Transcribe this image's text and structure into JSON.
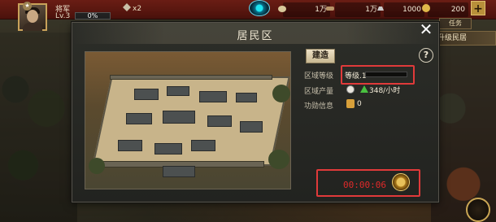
{
  "hud": {
    "player_title": "将军",
    "player_level": "Lv.3",
    "exp_percent": "0%",
    "multiplier": "x2",
    "resources": [
      {
        "name": "grain",
        "icon": "bag-icon",
        "value": "1万"
      },
      {
        "name": "wood",
        "icon": "log-icon",
        "value": "1万"
      },
      {
        "name": "iron",
        "icon": "ingot-icon",
        "value": "1000"
      },
      {
        "name": "gold",
        "icon": "coin-icon",
        "value": "200"
      }
    ]
  },
  "side": {
    "task_tab": "任务",
    "upgrade_tag": "升级民居"
  },
  "modal": {
    "title": "居民区",
    "build_button": "建造",
    "help_button": "?",
    "close_button": "✕",
    "info": {
      "level_label": "区域等级",
      "level_value": "等级.1",
      "production_label": "区域产量",
      "production_value": "348/小时",
      "merit_label": "功勋信息",
      "merit_value": "0"
    },
    "timer": "00:00:06"
  },
  "colors": {
    "highlight": "#e03a3a",
    "timer": "#e02a2a",
    "hud_red": "#6a1d14"
  }
}
